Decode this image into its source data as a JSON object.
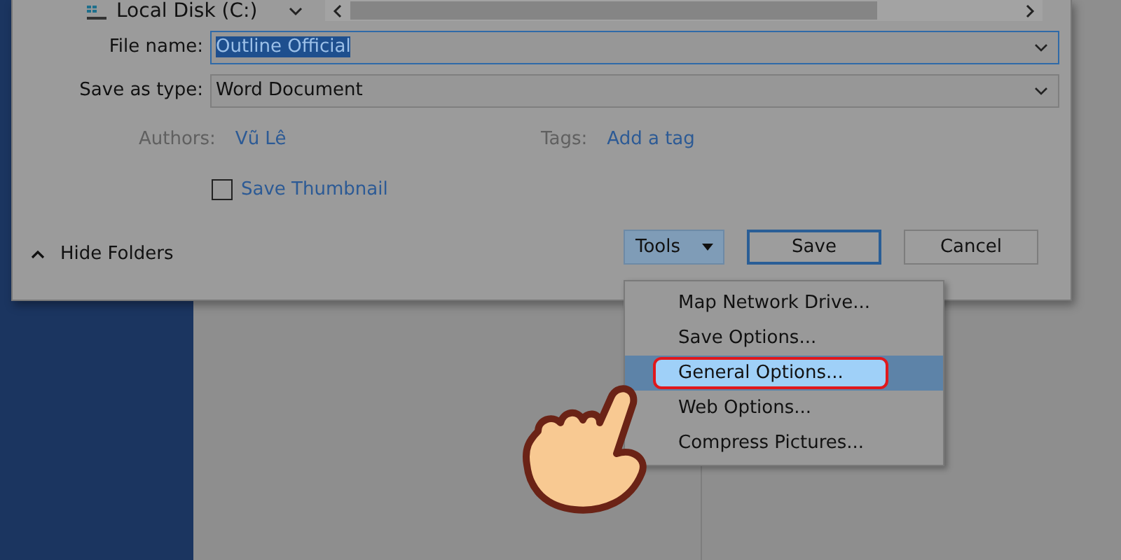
{
  "nav": {
    "location": "Local Disk (C:)"
  },
  "fields": [
    {
      "label": "File name:",
      "value": "Outline Official",
      "focused": true
    },
    {
      "label": "Save as type:",
      "value": "Word Document",
      "focused": false
    }
  ],
  "meta": [
    {
      "label": "Authors:",
      "value": "Vũ Lê"
    },
    {
      "label": "Tags:",
      "value": "Add a tag"
    }
  ],
  "save_thumbnail": {
    "label": "Save Thumbnail",
    "checked": false
  },
  "hide_folders": "Hide Folders",
  "buttons": [
    {
      "label": "Tools",
      "kind": "dropdown"
    },
    {
      "label": "Save",
      "kind": "default"
    },
    {
      "label": "Cancel",
      "kind": "normal"
    }
  ],
  "menu": [
    {
      "label": "Map Network Drive...",
      "selected": false
    },
    {
      "label": "Save Options...",
      "selected": false
    },
    {
      "label": "General Options...",
      "selected": true
    },
    {
      "label": "Web Options...",
      "selected": false
    },
    {
      "label": "Compress Pictures...",
      "selected": false
    }
  ]
}
